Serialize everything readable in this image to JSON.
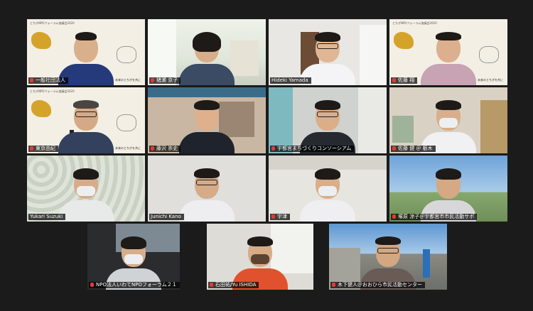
{
  "meeting": {
    "banner_title": "とちぎNPOフォーラム協議会2020",
    "slogan": "未来のとちぎを共に",
    "active_speaker": "tile-2"
  },
  "tiles": [
    {
      "label": "一般社団法人",
      "mic_muted": true
    },
    {
      "label": "猪瀬 京子",
      "mic_muted": true
    },
    {
      "label": "Hideki Yamada",
      "mic_muted": false
    },
    {
      "label": "佐藤 翔",
      "mic_muted": true
    },
    {
      "label": "東京由紀",
      "mic_muted": true
    },
    {
      "label": "藤沢 崇史",
      "mic_muted": true
    },
    {
      "label": "宇都宮まちづくりコンソーシアム",
      "mic_muted": true
    },
    {
      "label": "佐藤 健 ＠ 栃木",
      "mic_muted": true
    },
    {
      "label": "Yukari Suzuki",
      "mic_muted": false
    },
    {
      "label": "Junichi Kano",
      "mic_muted": false
    },
    {
      "label": "宇津",
      "mic_muted": true
    },
    {
      "label": "塚原 涼子＠宇都宮市市民活動サポ",
      "mic_muted": true
    },
    {
      "label": "NPO法人いわてNPOフォーラム２１",
      "mic_muted": true
    },
    {
      "label": "石田祐/Yu ISHIDA",
      "mic_muted": true
    },
    {
      "label": "木下健人＠おおひら市民活動センター",
      "mic_muted": true
    }
  ]
}
